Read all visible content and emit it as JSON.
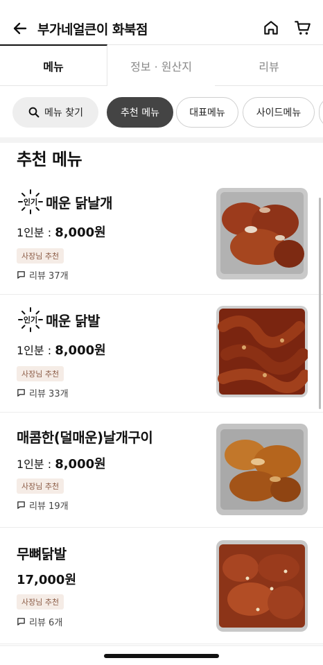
{
  "header": {
    "title": "부가네얼큰이 화북점"
  },
  "tabs": [
    {
      "label": "메뉴"
    },
    {
      "label": "정보 · 원산지"
    },
    {
      "label": "리뷰"
    }
  ],
  "chips": {
    "search_label": "메뉴 찾기",
    "items": [
      {
        "label": "추천 메뉴"
      },
      {
        "label": "대표메뉴"
      },
      {
        "label": "사이드메뉴"
      },
      {
        "label": ""
      }
    ]
  },
  "section": {
    "title": "추천 메뉴"
  },
  "popular_badge_label": "인기",
  "menu_items": [
    {
      "name": "매운 닭날개",
      "popular": true,
      "price_prefix": "1인분 : ",
      "price": "8,000원",
      "tag": "사장님 추천",
      "review": "리뷰 37개",
      "photo_color": "#9c3b1c"
    },
    {
      "name": "매운 닭발",
      "popular": true,
      "price_prefix": "1인분 : ",
      "price": "8,000원",
      "tag": "사장님 추천",
      "review": "리뷰 33개",
      "photo_color": "#8a2c16"
    },
    {
      "name": "매콤한(덜매운)날개구이",
      "popular": false,
      "price_prefix": "1인분 : ",
      "price": "8,000원",
      "tag": "사장님 추천",
      "review": "리뷰 19개",
      "photo_color": "#b5651d"
    },
    {
      "name": "무뼈닭발",
      "popular": false,
      "price_prefix": "",
      "price": "17,000원",
      "tag": "사장님 추천",
      "review": "리뷰 6개",
      "photo_color": "#a0401f"
    }
  ],
  "colors": {
    "active_chip": "#444444",
    "tag_bg": "#f5ece6",
    "tag_text": "#8a5a44"
  },
  "icons": [
    "back-arrow-icon",
    "home-icon",
    "cart-icon",
    "search-icon",
    "review-bubble-icon",
    "popular-badge-icon"
  ]
}
